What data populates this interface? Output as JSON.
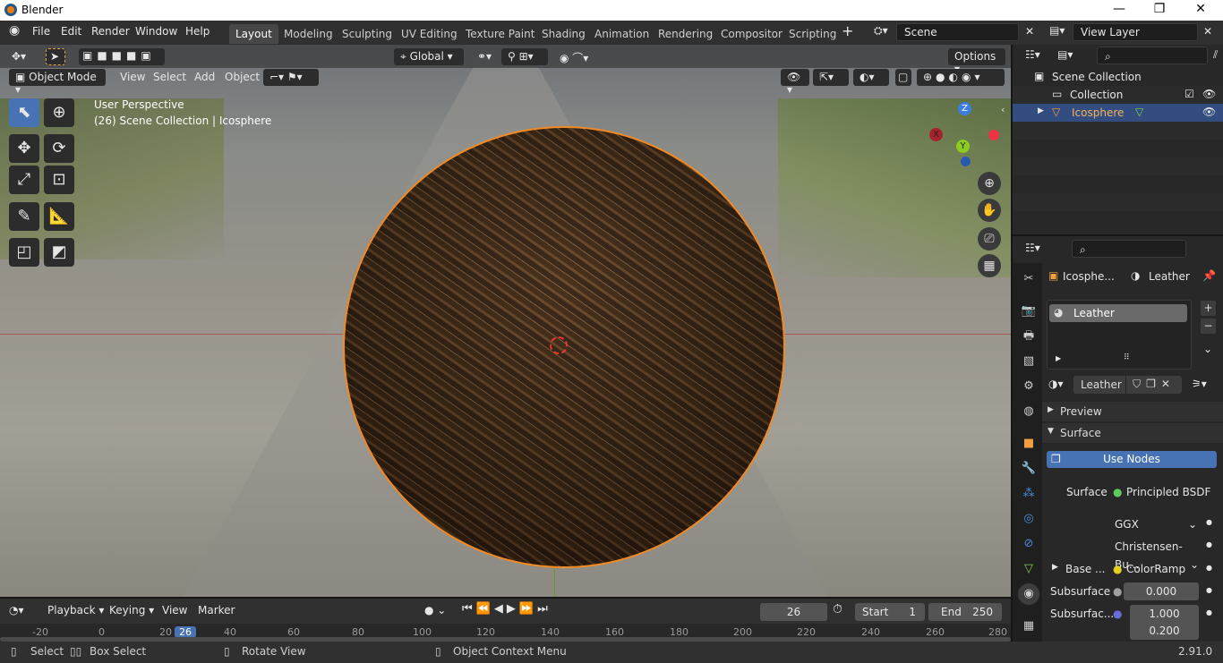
{
  "window": {
    "title": "Blender",
    "controls": [
      "—",
      "❐",
      "✕"
    ]
  },
  "menu": [
    "File",
    "Edit",
    "Render",
    "Window",
    "Help"
  ],
  "workspaces": [
    "Layout",
    "Modeling",
    "Sculpting",
    "UV Editing",
    "Texture Paint",
    "Shading",
    "Animation",
    "Rendering",
    "Compositor",
    "Scripting"
  ],
  "scene": {
    "name": "Scene",
    "view_layer": "View Layer"
  },
  "toolbar": {
    "transform_orientation": "Global",
    "options_label": "Options"
  },
  "viewport": {
    "mode": "Object Mode",
    "menus": [
      "View",
      "Select",
      "Add",
      "Object"
    ],
    "overlay_line1": "User Perspective",
    "overlay_line2": "(26) Scene Collection | Icosphere",
    "gizmo": {
      "z": "Z",
      "y": "Y",
      "x": "X"
    }
  },
  "outliner": {
    "root": "Scene Collection",
    "collection": "Collection",
    "object": "Icosphere"
  },
  "properties": {
    "object_name": "Icosphe...",
    "material_name": "Leather",
    "slot_material": "Leather",
    "datablock_name": "Leather",
    "panels": {
      "preview": "Preview",
      "surface": "Surface"
    },
    "use_nodes": "Use Nodes",
    "surface_label": "Surface",
    "surface_value": "Principled BSDF",
    "distribution": "GGX",
    "subsurface_method": "Christensen-Bu...",
    "base_color_label": "Base ...",
    "base_color_value": "ColorRamp",
    "subsurface_label": "Subsurface",
    "subsurface_value": "0.000",
    "subsurface_radius_label": "Subsurfac...",
    "subsurface_radius_1": "1.000",
    "subsurface_radius_2": "0.200"
  },
  "timeline": {
    "menus": [
      "Playback",
      "Keying",
      "View",
      "Marker"
    ],
    "current_frame": "26",
    "start_label": "Start",
    "start": "1",
    "end_label": "End",
    "end": "250",
    "ticks": [
      "-20",
      "0",
      "20",
      "26",
      "40",
      "60",
      "80",
      "100",
      "120",
      "140",
      "160",
      "180",
      "200",
      "220",
      "240",
      "260",
      "280"
    ]
  },
  "statusbar": {
    "select": "Select",
    "box_select": "Box Select",
    "rotate": "Rotate View",
    "context_menu": "Object Context Menu",
    "version": "2.91.0"
  },
  "colors": {
    "accent": "#4772b3",
    "selection": "#f08a24",
    "active_tab": "#474747"
  }
}
